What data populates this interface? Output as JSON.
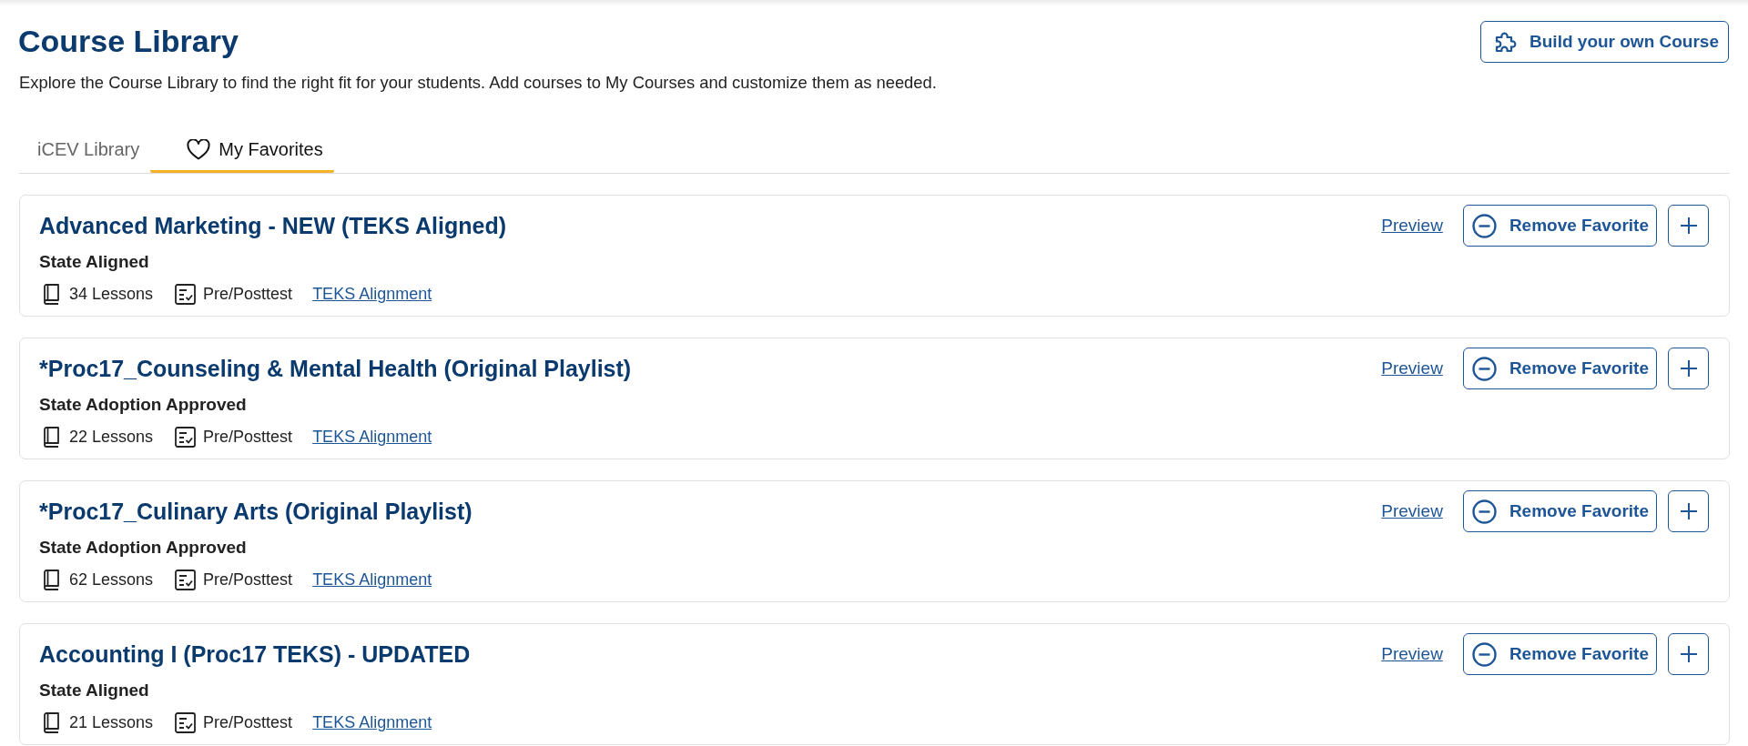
{
  "header": {
    "title": "Course Library",
    "description": "Explore the Course Library to find the right fit for your students. Add courses to My Courses and customize them as needed.",
    "build_button": "Build your own Course"
  },
  "tabs": [
    {
      "label": "iCEV Library",
      "kind": "text",
      "selected": false
    },
    {
      "label": "My Favorites",
      "kind": "favorites",
      "selected": true
    }
  ],
  "courses": [
    {
      "title": "Advanced Marketing - NEW (TEKS Aligned)",
      "status": "State Aligned",
      "lessons": "34 Lessons",
      "assessment": "Pre/Posttest",
      "alignment_link": "TEKS Alignment",
      "preview_link": "Preview",
      "remove_button": "Remove Favorite"
    },
    {
      "title": "*Proc17_Counseling & Mental Health (Original Playlist)",
      "status": "State Adoption Approved",
      "lessons": "22 Lessons",
      "assessment": "Pre/Posttest",
      "alignment_link": "TEKS Alignment",
      "preview_link": "Preview",
      "remove_button": "Remove Favorite"
    },
    {
      "title": "*Proc17_Culinary Arts (Original Playlist)",
      "status": "State Adoption Approved",
      "lessons": "62 Lessons",
      "assessment": "Pre/Posttest",
      "alignment_link": "TEKS Alignment",
      "preview_link": "Preview",
      "remove_button": "Remove Favorite"
    },
    {
      "title": "Accounting I (Proc17 TEKS) - UPDATED",
      "status": "State Aligned",
      "lessons": "21 Lessons",
      "assessment": "Pre/Posttest",
      "alignment_link": "TEKS Alignment",
      "preview_link": "Preview",
      "remove_button": "Remove Favorite"
    }
  ]
}
